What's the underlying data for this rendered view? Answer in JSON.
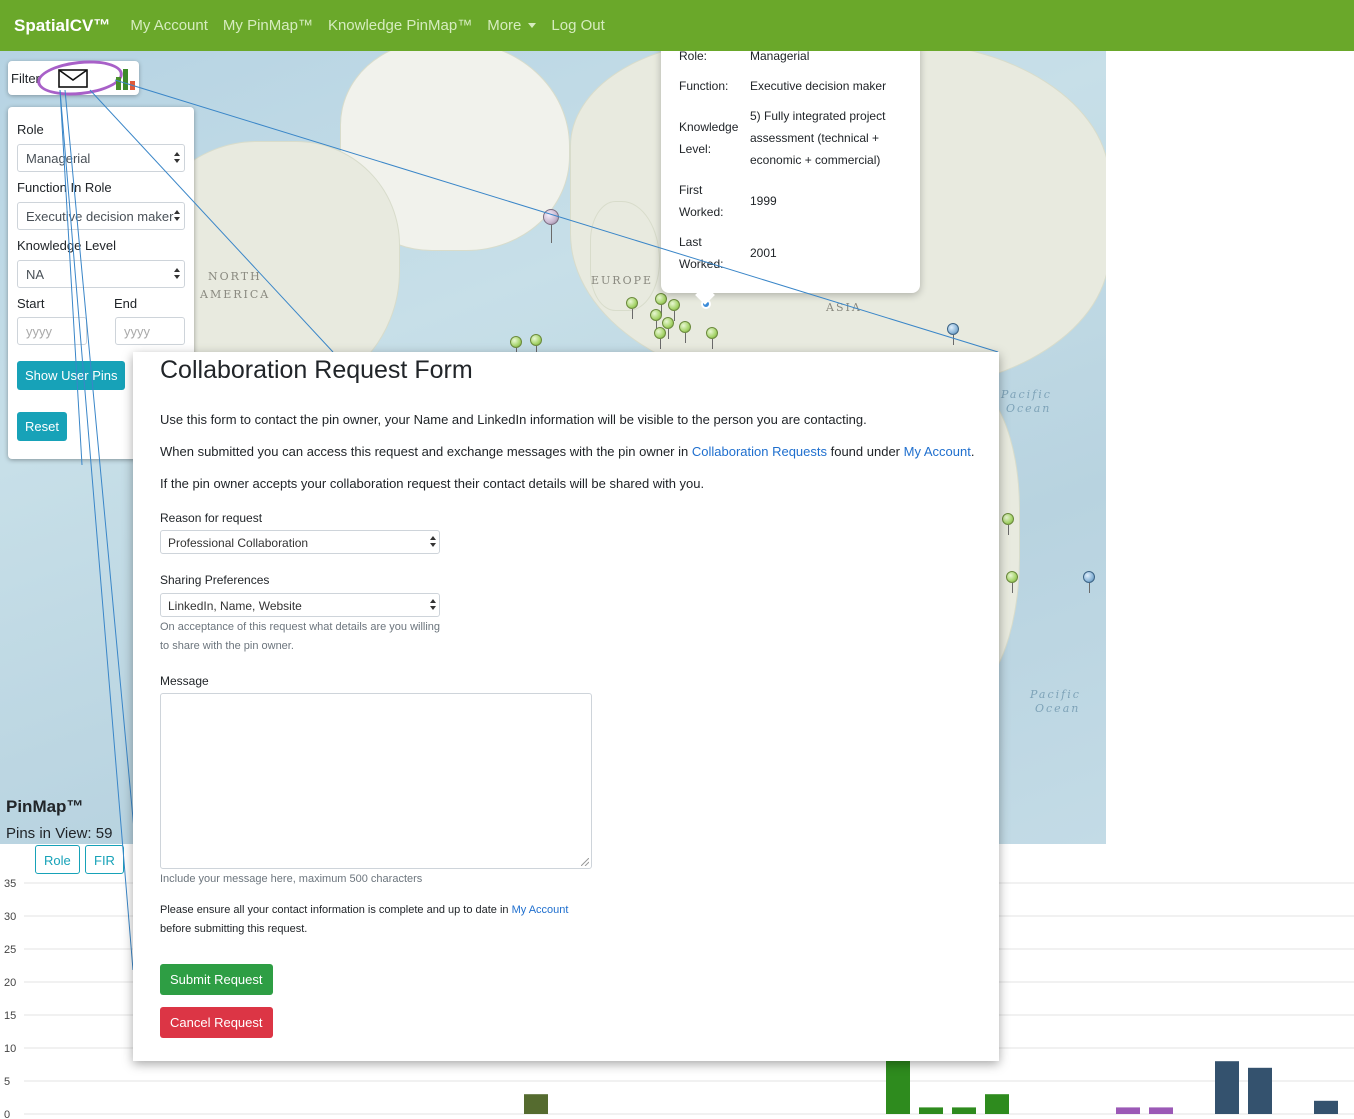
{
  "nav": {
    "brand": "SpatialCV™",
    "items": [
      "My Account",
      "My PinMap™",
      "Knowledge PinMap™",
      "More",
      "Log Out"
    ]
  },
  "map": {
    "labels": {
      "north": "NORTH",
      "america": "AMERICA",
      "europe": "EUROPE",
      "asia": "ASIA",
      "pacific1": "Pacific",
      "ocean1": "Ocean",
      "pacific2": "Pacific",
      "ocean2": "Ocean"
    }
  },
  "filter": {
    "tab_label": "Filter",
    "role_label": "Role",
    "role_value": "Managerial",
    "function_label": "Function In Role",
    "function_value": "Executive decision maker",
    "knowledge_label": "Knowledge Level",
    "knowledge_value": "NA",
    "start_label": "Start",
    "end_label": "End",
    "start_placeholder": "yyyy",
    "end_placeholder": "yyyy",
    "show_button": "Show User Pins",
    "reset_button": "Reset"
  },
  "popup": {
    "role_key": "Role:",
    "role_val": "Managerial",
    "function_key": "Function:",
    "function_val": "Executive decision maker",
    "knowledge_key1": "Knowledge",
    "knowledge_key2": "Level:",
    "knowledge_val1": "5) Fully integrated project",
    "knowledge_val2": "assessment (technical +",
    "knowledge_val3": "economic + commercial)",
    "first_key1": "First",
    "first_key2": "Worked:",
    "first_val": "1999",
    "last_key1": "Last",
    "last_key2": "Worked:",
    "last_val": "2001"
  },
  "pinmap": {
    "title": "PinMap™",
    "pins_in_view": "Pins in View: 59",
    "tabs": [
      "Role",
      "FIR"
    ]
  },
  "chart_data": {
    "type": "bar",
    "yticks": [
      "35",
      "30",
      "25",
      "20",
      "15",
      "10",
      "5",
      "0"
    ],
    "ylim": [
      0,
      35
    ],
    "bars": [
      {
        "value": 3,
        "color": "#556b2f"
      },
      {
        "value": 9,
        "color": "#2e8b1e"
      },
      {
        "value": 1,
        "color": "#2e8b1e"
      },
      {
        "value": 1,
        "color": "#2e8b1e"
      },
      {
        "value": 3,
        "color": "#2e8b1e"
      },
      {
        "value": 1,
        "color": "#9b59b6"
      },
      {
        "value": 1,
        "color": "#9b59b6"
      },
      {
        "value": 8,
        "color": "#34526e"
      },
      {
        "value": 7,
        "color": "#34526e"
      },
      {
        "value": 2,
        "color": "#34526e"
      }
    ]
  },
  "modal": {
    "title": "Collaboration Request Form",
    "p1": "Use this form to contact the pin owner, your Name and LinkedIn information will be visible to the person you are contacting.",
    "p2_a": "When submitted you can access this request and exchange messages with the pin owner in ",
    "p2_link1": "Collaboration Requests",
    "p2_b": " found under ",
    "p2_link2": "My Account",
    "p2_c": ".",
    "p3": "If the pin owner accepts your collaboration request their contact details will be shared with you.",
    "reason_label": "Reason for request",
    "reason_value": "Professional Collaboration",
    "sharing_label": "Sharing Preferences",
    "sharing_value": "LinkedIn, Name, Website",
    "sharing_help1": "On acceptance of this request what details are you willing",
    "sharing_help2": "to share with the pin owner.",
    "message_label": "Message",
    "message_help": "Include your message here, maximum 500 characters",
    "ensure_a": "Please ensure all your contact information is complete and up to date in ",
    "ensure_link": "My Account",
    "ensure_b": "before submitting this request.",
    "submit": "Submit Request",
    "cancel": "Cancel Request"
  }
}
